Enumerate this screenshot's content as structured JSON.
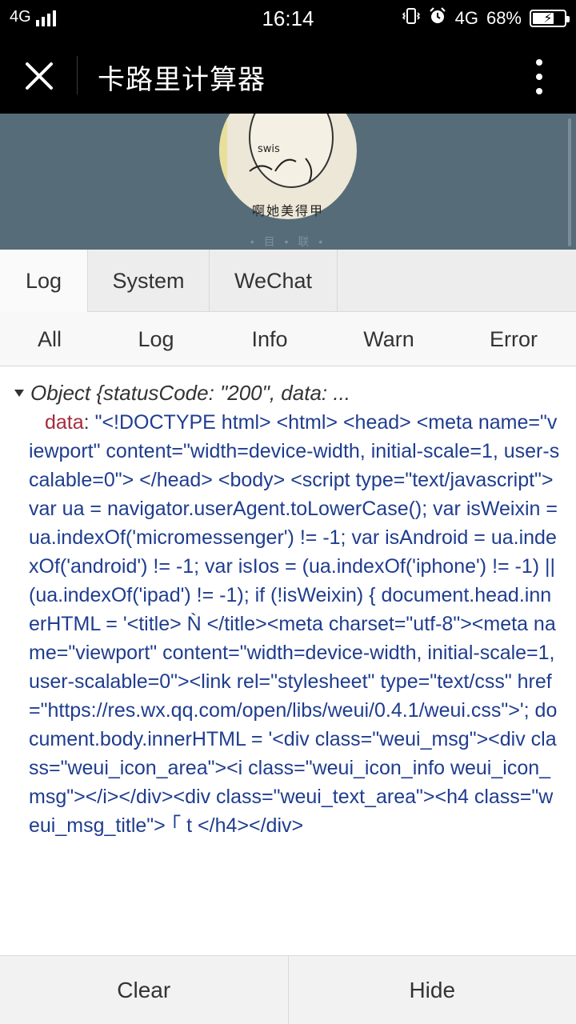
{
  "status_bar": {
    "network_left": "4G",
    "time": "16:14",
    "network_right": "4G",
    "battery_percent": "68%",
    "battery_level": 0.68
  },
  "title_bar": {
    "title": "卡路里计算器"
  },
  "background_page": {
    "sticker_caption": "啊她美得甲",
    "sticker_text": "swis",
    "subtext": "• 目 • 联 •"
  },
  "console": {
    "tabs": [
      {
        "label": "Log",
        "active": true
      },
      {
        "label": "System",
        "active": false
      },
      {
        "label": "WeChat",
        "active": false
      }
    ],
    "filters": [
      "All",
      "Log",
      "Info",
      "Warn",
      "Error"
    ],
    "log_entry": {
      "summary": "Object {statusCode: \"200\", data: ...",
      "key": "data",
      "value": "\"<!DOCTYPE html> <html> <head> <meta name=\"viewport\" content=\"width=device-width, initial-scale=1, user-scalable=0\"> </head> <body> <script type=\"text/javascript\"> var ua = navigator.userAgent.toLowerCase(); var isWeixin = ua.indexOf('micromessenger') != -1; var isAndroid = ua.indexOf('android') != -1; var isIos = (ua.indexOf('iphone') != -1) || (ua.indexOf('ipad') != -1); if (!isWeixin) { document.head.innerHTML = '<title>  Ǹ        </title><meta charset=\"utf-8\"><meta name=\"viewport\" content=\"width=device-width, initial-scale=1, user-scalable=0\"><link rel=\"stylesheet\" type=\"text/css\" href=\"https://res.wx.qq.com/open/libs/weui/0.4.1/weui.css\">'; document.body.innerHTML = '<div class=\"weui_msg\"><div class=\"weui_icon_area\"><i class=\"weui_icon_info weui_icon_msg\"></i></div><div class=\"weui_text_area\"><h4 class=\"weui_msg_title\">          ｢     t  </h4></div>"
    },
    "actions": {
      "clear": "Clear",
      "hide": "Hide"
    }
  }
}
